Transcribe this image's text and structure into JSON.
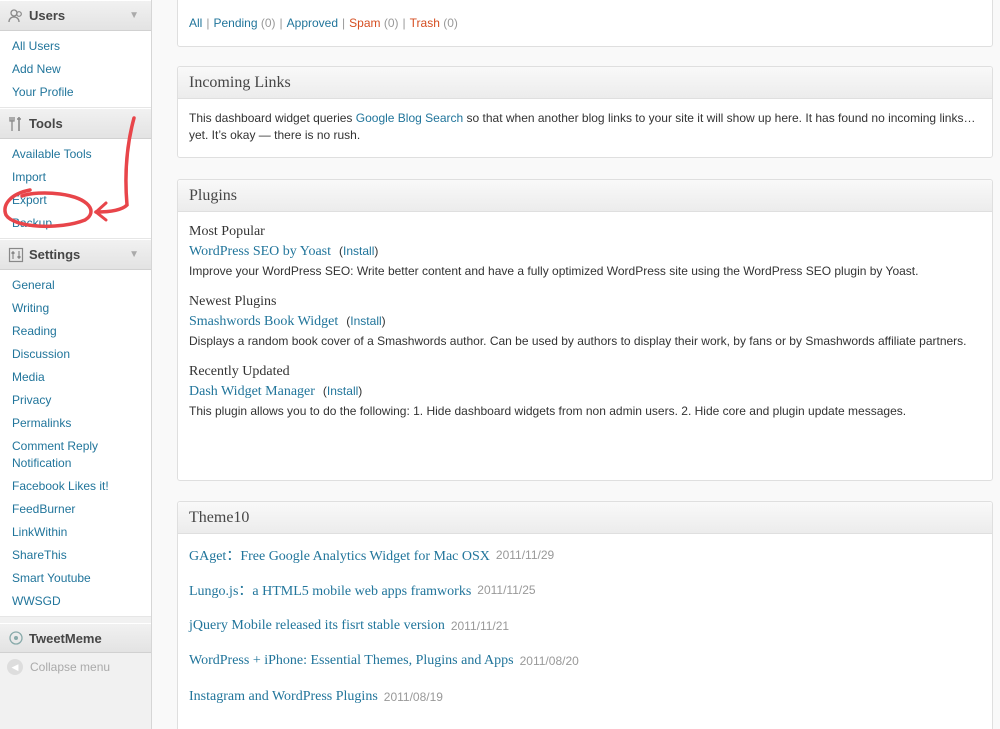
{
  "sidebar": {
    "users": {
      "title": "Users",
      "items": [
        "All Users",
        "Add New",
        "Your Profile"
      ]
    },
    "tools": {
      "title": "Tools",
      "items": [
        "Available Tools",
        "Import",
        "Export",
        "Backup"
      ]
    },
    "settings": {
      "title": "Settings",
      "items": [
        "General",
        "Writing",
        "Reading",
        "Discussion",
        "Media",
        "Privacy",
        "Permalinks",
        "Comment Reply Notification",
        "Facebook Likes it!",
        "FeedBurner",
        "LinkWithin",
        "ShareThis",
        "Smart Youtube",
        "WWSGD"
      ]
    },
    "tweetmeme": {
      "title": "TweetMeme"
    },
    "collapse_label": "Collapse menu"
  },
  "comments_filter": {
    "all": "All",
    "pending": "Pending",
    "pending_count": "(0)",
    "approved": "Approved",
    "spam": "Spam",
    "spam_count": "(0)",
    "trash": "Trash",
    "trash_count": "(0)"
  },
  "incoming_links": {
    "title": "Incoming Links",
    "text_before": "This dashboard widget queries ",
    "link": "Google Blog Search",
    "text_after": " so that when another blog links to your site it will show up here. It has found no incoming links… yet. It’s okay — there is no rush."
  },
  "plugins": {
    "title": "Plugins",
    "install_label": "Install",
    "sections": [
      {
        "heading": "Most Popular",
        "name": "WordPress SEO by Yoast",
        "desc": "Improve your WordPress SEO: Write better content and have a fully optimized WordPress site using the WordPress SEO plugin by Yoast."
      },
      {
        "heading": "Newest Plugins",
        "name": "Smashwords Book Widget",
        "desc": "Displays a random book cover of a Smashwords author. Can be used by authors to display their work, by fans or by Smashwords affiliate partners."
      },
      {
        "heading": "Recently Updated",
        "name": "Dash Widget Manager",
        "desc": "This plugin allows you to do the following: 1. Hide dashboard widgets from non admin users. 2. Hide core and plugin update messages."
      }
    ]
  },
  "theme10": {
    "title": "Theme10",
    "posts": [
      {
        "title": "GAget：Free Google Analytics Widget for Mac OSX",
        "date": "2011/11/29"
      },
      {
        "title": "Lungo.js：a HTML5 mobile web apps framworks",
        "date": "2011/11/25"
      },
      {
        "title": "jQuery Mobile released its fisrt stable version",
        "date": "2011/11/21"
      },
      {
        "title": "WordPress + iPhone: Essential Themes, Plugins and Apps",
        "date": "2011/08/20"
      },
      {
        "title": "Instagram and WordPress Plugins",
        "date": "2011/08/19"
      }
    ]
  },
  "colors": {
    "link": "#21759b",
    "spam": "#d54e21",
    "annotation": "#e8454a"
  }
}
